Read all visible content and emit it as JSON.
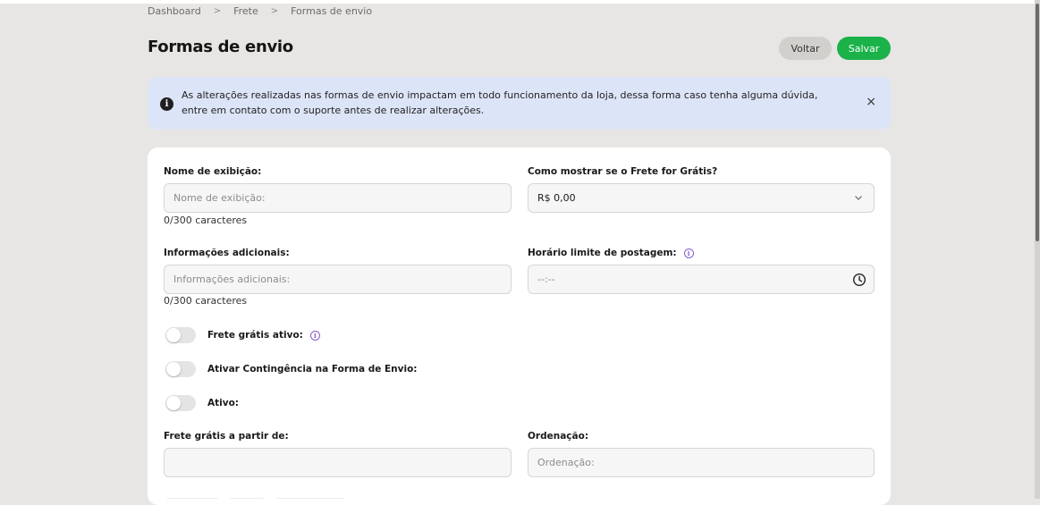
{
  "breadcrumb": {
    "items": [
      "Dashboard",
      "Frete",
      "Formas de envio"
    ],
    "separator": ">"
  },
  "page": {
    "title": "Formas de envio"
  },
  "actions": {
    "back_label": "Voltar",
    "save_label": "Salvar"
  },
  "alert": {
    "icon": "info-icon",
    "message": "As alterações realizadas nas formas de envio impactam em todo funcionamento da loja, dessa forma caso tenha alguma dúvida, entre em contato com o suporte antes de realizar alterações.",
    "close": "×"
  },
  "form": {
    "display_name": {
      "label": "Nome de exibição:",
      "placeholder": "Nome de exibição:",
      "counter": "0/300 caracteres"
    },
    "free_shipping_display": {
      "label": "Como mostrar se o Frete for Grátis?",
      "value": "R$ 0,00"
    },
    "additional_info": {
      "label": "Informações adicionais:",
      "placeholder": "Informações adicionais:",
      "counter": "0/300 caracteres"
    },
    "posting_deadline": {
      "label": "Horário limite de postagem:",
      "value": "--:--",
      "info": "i"
    },
    "toggles": [
      {
        "label": "Frete grátis ativo:",
        "on": false,
        "info": "i"
      },
      {
        "label": "Ativar Contingência na Forma de Envio:",
        "on": false
      },
      {
        "label": "Ativo:",
        "on": false
      }
    ],
    "free_from": {
      "label": "Frete grátis a partir de:",
      "value": ""
    },
    "ordering": {
      "label": "Ordenação:",
      "placeholder": "Ordenação:"
    }
  },
  "colors": {
    "accent_save": "#1bb24a",
    "alert_bg": "#dce5f7",
    "info_purple": "#8a5cc9",
    "page_bg": "#e8e6e4"
  }
}
